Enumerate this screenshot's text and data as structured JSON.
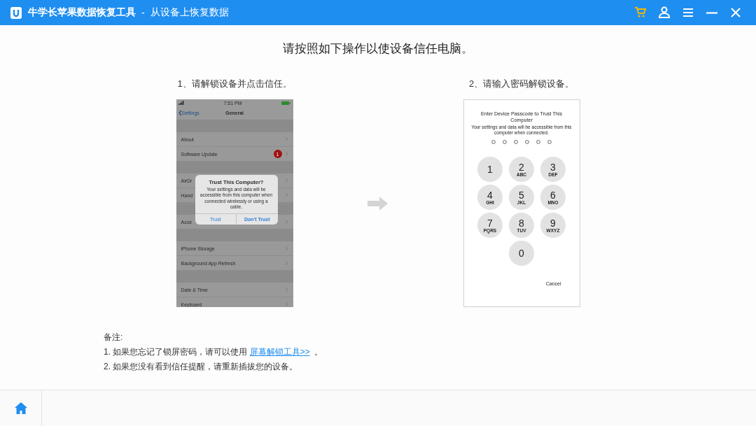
{
  "window": {
    "title": "牛学长苹果数据恢复工具",
    "separator": "-",
    "subtitle": "从设备上恢复数据"
  },
  "heading": "请按照如下操作以使设备信任电脑。",
  "steps": [
    {
      "kind": "settings-screen",
      "label": "1、请解锁设备并点击信任。",
      "time": "7:51 PM",
      "back": "Settings",
      "screen_title": "General",
      "sections": [
        [
          {
            "label": "About"
          },
          {
            "label": "Software Update",
            "badge": "1"
          }
        ],
        [
          {
            "label": "AirDr"
          },
          {
            "label": "Hand"
          }
        ],
        [
          {
            "label": "Acce"
          }
        ],
        [
          {
            "label": "iPhone Storage"
          },
          {
            "label": "Background App Refresh"
          }
        ],
        [
          {
            "label": "Date & Time"
          },
          {
            "label": "Keyboard"
          }
        ]
      ],
      "dialog": {
        "title": "Trust This Computer?",
        "message": "Your settings and data will be accessible from this computer when connected wirelessly or using a cable.",
        "buttons": [
          {
            "label": "Trust",
            "kind": "plain"
          },
          {
            "label": "Don't Trust",
            "kind": "bold"
          }
        ]
      }
    },
    {
      "kind": "passcode-screen",
      "label": "2、请输入密码解锁设备。",
      "title": "Enter Device Passcode to Trust This Computer",
      "message": "Your settings and data will be accessible from this computer when connected.",
      "keys": [
        {
          "digit": "1"
        },
        {
          "digit": "2",
          "letters": "ABC"
        },
        {
          "digit": "3",
          "letters": "DEF"
        },
        {
          "digit": "4",
          "letters": "GHI"
        },
        {
          "digit": "5",
          "letters": "JKL"
        },
        {
          "digit": "6",
          "letters": "MNO"
        },
        {
          "digit": "7",
          "letters": "PQRS"
        },
        {
          "digit": "8",
          "letters": "TUV"
        },
        {
          "digit": "9",
          "letters": "WXYZ"
        },
        {
          "digit": "0"
        }
      ],
      "cancel": "Cancel"
    }
  ],
  "notes": {
    "title": "备注:",
    "items": [
      {
        "text": "1. 如果您忘记了锁屏密码，请可以使用",
        "link": "屏幕解锁工具>>",
        "after": "。"
      },
      {
        "text": "2. 如果您没有看到信任提醒，请重新插拔您的设备。"
      }
    ]
  }
}
